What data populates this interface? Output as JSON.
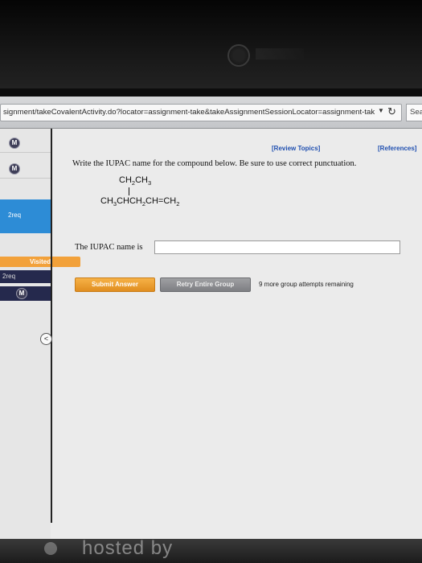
{
  "browser": {
    "url": "signment/takeCovalentActivity.do?locator=assignment-take&takeAssignmentSessionLocator=assignment-tak",
    "url_dropdown_icon": "chevron-down-icon",
    "reload_icon": "reload-icon",
    "search_placeholder": "Sea"
  },
  "sidebar": {
    "m_label": "M",
    "active_item": "2req",
    "visited_label": "Visited",
    "small_item": "2req",
    "collapse_glyph": "<"
  },
  "links": {
    "review": "[Review Topics]",
    "references": "[References]"
  },
  "question": {
    "prompt": "Write the IUPAC name for the compound below. Be sure to use correct punctuation.",
    "answer_label": "The IUPAC name is",
    "answer_value": ""
  },
  "actions": {
    "submit": "Submit Answer",
    "retry": "Retry Entire Group",
    "attempts_remaining": "9 more group attempts remaining"
  },
  "watermark": "hosted by",
  "colors": {
    "accent_blue": "#2d8cd6",
    "submit_orange": "#f2a13a",
    "link_blue": "#1f4fb0"
  }
}
